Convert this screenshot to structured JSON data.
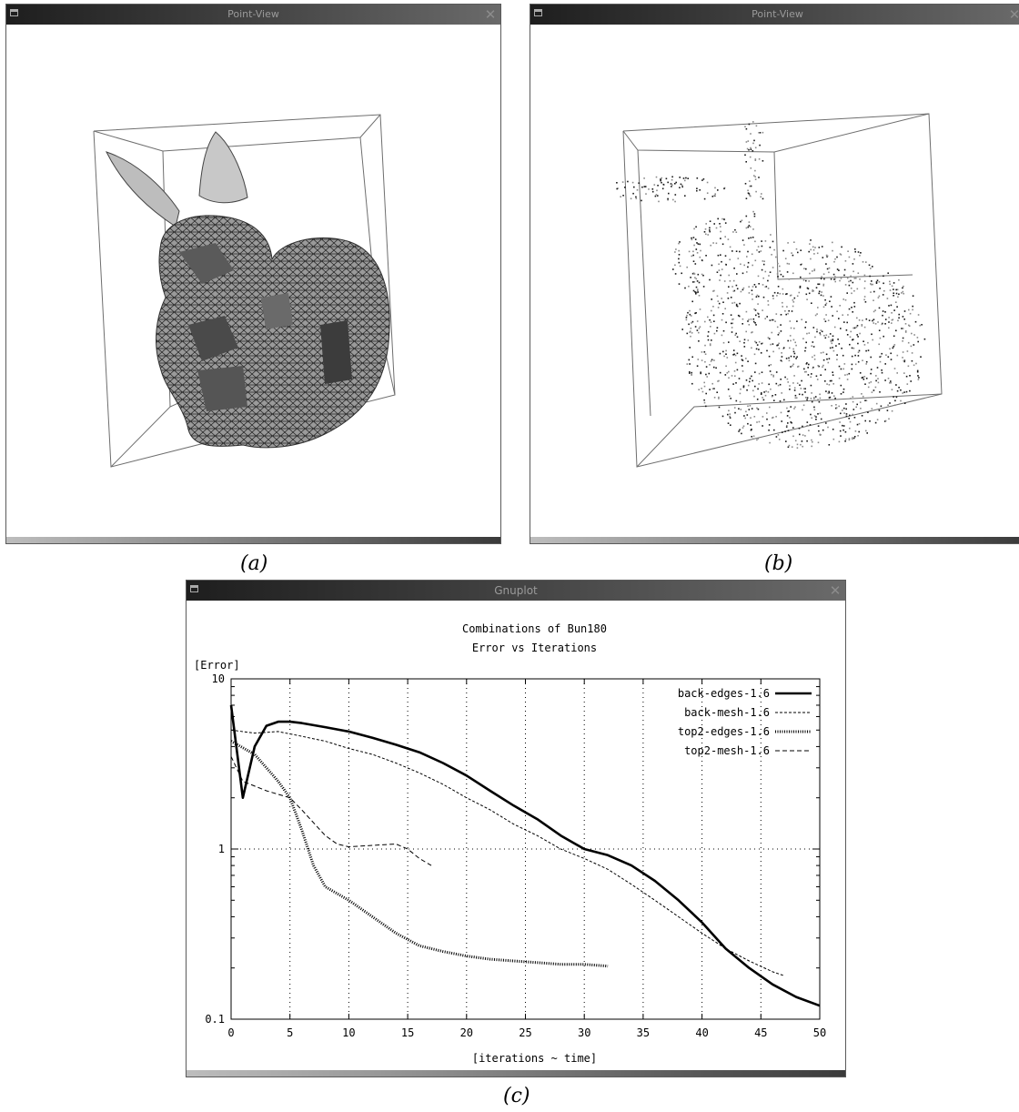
{
  "windows": {
    "a": {
      "title": "Point-View",
      "close_glyph": "✕"
    },
    "b": {
      "title": "Point-View",
      "close_glyph": "✕"
    },
    "c": {
      "title": "Gnuplot",
      "close_glyph": "✕"
    }
  },
  "captions": {
    "a": "(a)",
    "b": "(b)",
    "c": "(c)"
  },
  "chart_data": {
    "type": "line",
    "title": "Combinations of Bun180",
    "subtitle": "Error vs Iterations",
    "xlabel": "[iterations ~ time]",
    "ylabel": "[Error]",
    "xlim": [
      0,
      50
    ],
    "ylim": [
      0.1,
      10
    ],
    "y_scale": "log",
    "x_ticks": [
      "0",
      "5",
      "10",
      "15",
      "20",
      "25",
      "30",
      "35",
      "40",
      "45",
      "50"
    ],
    "y_ticks": [
      "0.1",
      "1",
      "10"
    ],
    "grid": true,
    "legend_position": "top-right",
    "series": [
      {
        "name": "back-edges-1.6",
        "style": "solid-thick",
        "points": [
          [
            0,
            7.0
          ],
          [
            1,
            2.0
          ],
          [
            2,
            4.0
          ],
          [
            3,
            5.3
          ],
          [
            4,
            5.6
          ],
          [
            5,
            5.6
          ],
          [
            6,
            5.5
          ],
          [
            8,
            5.2
          ],
          [
            10,
            4.9
          ],
          [
            12,
            4.5
          ],
          [
            14,
            4.1
          ],
          [
            16,
            3.7
          ],
          [
            18,
            3.2
          ],
          [
            20,
            2.7
          ],
          [
            22,
            2.2
          ],
          [
            24,
            1.8
          ],
          [
            26,
            1.5
          ],
          [
            28,
            1.2
          ],
          [
            30,
            1.0
          ],
          [
            32,
            0.92
          ],
          [
            34,
            0.8
          ],
          [
            36,
            0.65
          ],
          [
            38,
            0.5
          ],
          [
            40,
            0.37
          ],
          [
            42,
            0.26
          ],
          [
            44,
            0.2
          ],
          [
            46,
            0.16
          ],
          [
            48,
            0.135
          ],
          [
            50,
            0.12
          ]
        ]
      },
      {
        "name": "back-mesh-1.6",
        "style": "dashed-fine",
        "points": [
          [
            0,
            5.0
          ],
          [
            2,
            4.8
          ],
          [
            4,
            4.9
          ],
          [
            6,
            4.6
          ],
          [
            8,
            4.3
          ],
          [
            10,
            3.9
          ],
          [
            12,
            3.6
          ],
          [
            14,
            3.2
          ],
          [
            16,
            2.8
          ],
          [
            18,
            2.4
          ],
          [
            20,
            2.0
          ],
          [
            22,
            1.7
          ],
          [
            24,
            1.4
          ],
          [
            26,
            1.2
          ],
          [
            28,
            1.0
          ],
          [
            30,
            0.88
          ],
          [
            32,
            0.76
          ],
          [
            34,
            0.62
          ],
          [
            36,
            0.5
          ],
          [
            38,
            0.4
          ],
          [
            40,
            0.32
          ],
          [
            42,
            0.26
          ],
          [
            44,
            0.22
          ],
          [
            46,
            0.19
          ],
          [
            47,
            0.18
          ]
        ]
      },
      {
        "name": "top2-edges-1.6",
        "style": "dotted-thick",
        "points": [
          [
            0,
            4.3
          ],
          [
            2,
            3.6
          ],
          [
            4,
            2.5
          ],
          [
            5,
            2.0
          ],
          [
            6,
            1.3
          ],
          [
            7,
            0.8
          ],
          [
            8,
            0.6
          ],
          [
            10,
            0.5
          ],
          [
            12,
            0.4
          ],
          [
            14,
            0.32
          ],
          [
            16,
            0.27
          ],
          [
            18,
            0.25
          ],
          [
            20,
            0.235
          ],
          [
            22,
            0.225
          ],
          [
            24,
            0.22
          ],
          [
            26,
            0.215
          ],
          [
            28,
            0.21
          ],
          [
            30,
            0.21
          ],
          [
            32,
            0.205
          ]
        ]
      },
      {
        "name": "top2-mesh-1.6",
        "style": "dashed",
        "points": [
          [
            0,
            3.5
          ],
          [
            1,
            2.5
          ],
          [
            3,
            2.2
          ],
          [
            5,
            2.0
          ],
          [
            6,
            1.7
          ],
          [
            8,
            1.2
          ],
          [
            9,
            1.07
          ],
          [
            10,
            1.03
          ],
          [
            12,
            1.05
          ],
          [
            14,
            1.07
          ],
          [
            15,
            1.0
          ],
          [
            16,
            0.88
          ],
          [
            17,
            0.8
          ]
        ]
      }
    ]
  }
}
